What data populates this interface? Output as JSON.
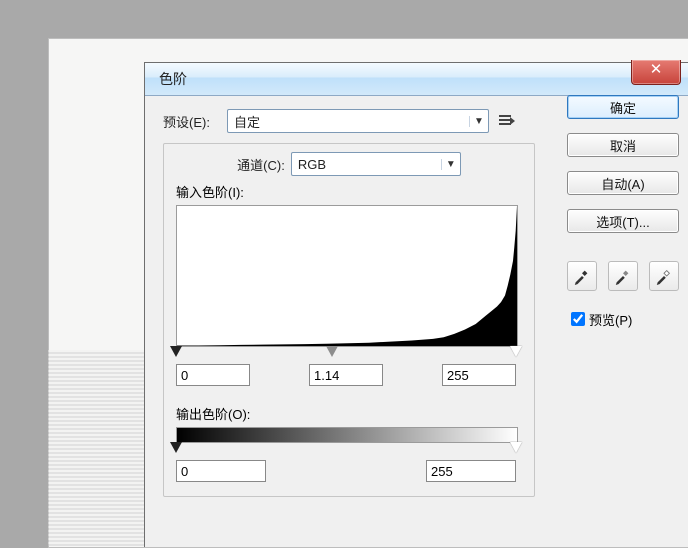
{
  "window": {
    "title": "色阶"
  },
  "preset": {
    "label": "预设(E):",
    "value": "自定"
  },
  "channel": {
    "label": "通道(C):",
    "value": "RGB"
  },
  "input_levels": {
    "label": "输入色阶(I):",
    "shadow": "0",
    "mid": "1.14",
    "highlight": "255"
  },
  "output_levels": {
    "label": "输出色阶(O):",
    "low": "0",
    "high": "255"
  },
  "buttons": {
    "ok": "确定",
    "cancel": "取消",
    "auto": "自动(A)",
    "options": "选项(T)..."
  },
  "preview": {
    "label": "预览(P)",
    "checked": true
  },
  "icons": {
    "dropdown_arrow": "▼",
    "close_x": "✕"
  },
  "chart_data": {
    "type": "area",
    "title": "",
    "xlabel": "",
    "ylabel": "",
    "x": [
      0,
      16,
      32,
      48,
      64,
      80,
      96,
      112,
      128,
      144,
      160,
      176,
      192,
      200,
      208,
      216,
      224,
      228,
      232,
      236,
      240,
      243,
      246,
      248,
      250,
      252,
      253,
      254,
      255
    ],
    "values": [
      1,
      1,
      1.5,
      2,
      2.5,
      3,
      3.5,
      4,
      5,
      6,
      8,
      10,
      13,
      16,
      22,
      30,
      40,
      48,
      56,
      64,
      72,
      80,
      92,
      110,
      130,
      155,
      180,
      210,
      255
    ],
    "ylim": [
      0,
      255
    ],
    "xlim": [
      0,
      255
    ]
  }
}
